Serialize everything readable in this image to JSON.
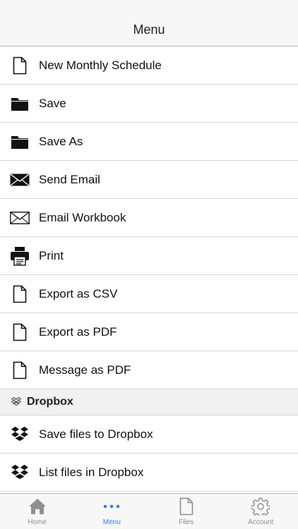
{
  "header": {
    "title": "Menu"
  },
  "menu_items": [
    {
      "label": "New Monthly Schedule",
      "icon": "document-icon"
    },
    {
      "label": "Save",
      "icon": "folder-icon"
    },
    {
      "label": "Save As",
      "icon": "folder-icon"
    },
    {
      "label": "Send Email",
      "icon": "envelope-filled-icon"
    },
    {
      "label": "Email Workbook",
      "icon": "envelope-outline-icon"
    },
    {
      "label": "Print",
      "icon": "printer-icon"
    },
    {
      "label": "Export as CSV",
      "icon": "document-icon"
    },
    {
      "label": "Export as PDF",
      "icon": "document-icon"
    },
    {
      "label": "Message as PDF",
      "icon": "document-icon"
    }
  ],
  "dropbox_section": {
    "title": "Dropbox",
    "icon": "dropbox-icon",
    "items": [
      {
        "label": "Save files to Dropbox",
        "icon": "dropbox-icon"
      },
      {
        "label": "List files in Dropbox",
        "icon": "dropbox-icon"
      }
    ]
  },
  "tabbar": {
    "tabs": [
      {
        "label": "Home",
        "icon": "home-icon",
        "active": false
      },
      {
        "label": "Menu",
        "icon": "more-dots-icon",
        "active": true
      },
      {
        "label": "Files",
        "icon": "file-icon",
        "active": false
      },
      {
        "label": "Account",
        "icon": "gear-icon",
        "active": false
      }
    ]
  },
  "colors": {
    "accent": "#2f7ef6",
    "inactive": "#8e8e93",
    "section_bg": "#f1f1f2"
  }
}
